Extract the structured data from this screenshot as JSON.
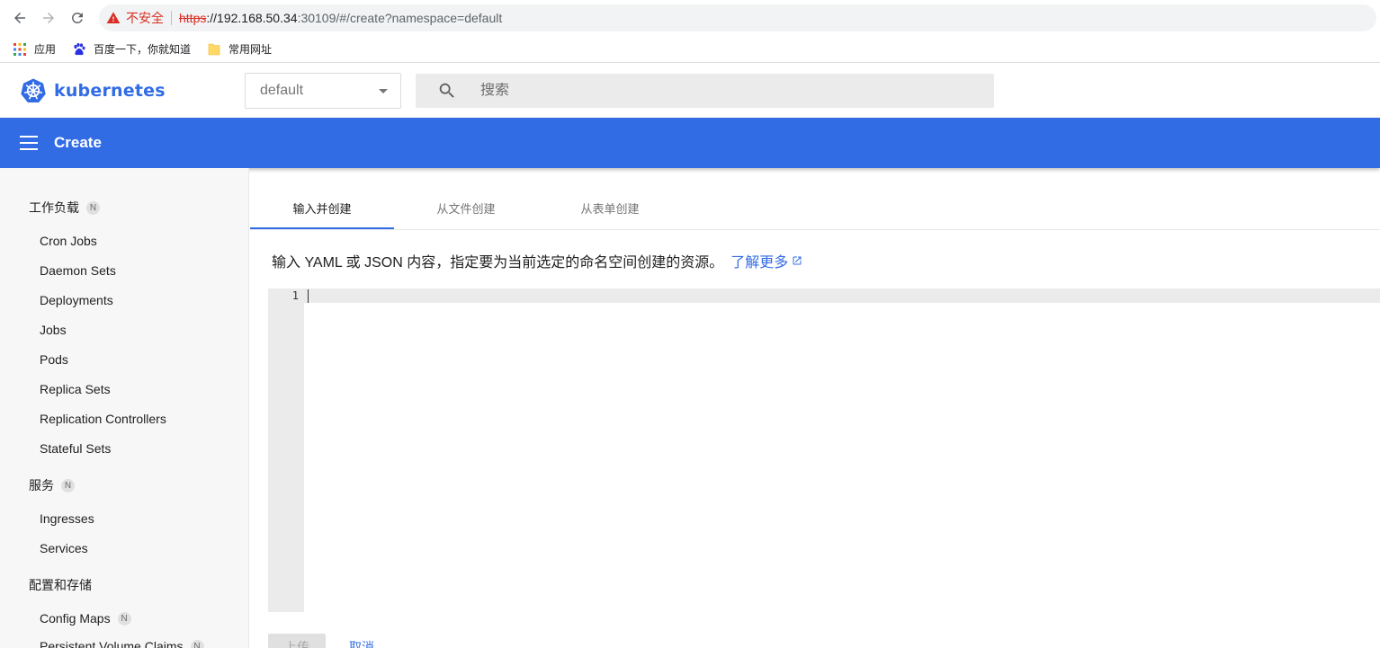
{
  "browser": {
    "security_label": "不安全",
    "url_scheme": "https",
    "url_host": "://192.168.50.34",
    "url_rest": ":30109/#/create?namespace=default",
    "bookmarks": [
      {
        "label": "应用",
        "icon": "apps-grid-icon"
      },
      {
        "label": "百度一下，你就知道",
        "icon": "baidu-paw-icon"
      },
      {
        "label": "常用网址",
        "icon": "folder-icon"
      }
    ]
  },
  "header": {
    "brand": "kubernetes",
    "namespace_selected": "default",
    "search_placeholder": "搜索"
  },
  "toolbar": {
    "title": "Create"
  },
  "sidebar": {
    "workloads": {
      "title": "工作负载",
      "badge": "N"
    },
    "workload_items": [
      "Cron Jobs",
      "Daemon Sets",
      "Deployments",
      "Jobs",
      "Pods",
      "Replica Sets",
      "Replication Controllers",
      "Stateful Sets"
    ],
    "services": {
      "title": "服务",
      "badge": "N"
    },
    "service_items": [
      "Ingresses",
      "Services"
    ],
    "config": {
      "title": "配置和存储"
    },
    "config_items": [
      {
        "label": "Config Maps",
        "badge": "N"
      },
      {
        "label": "Persistent Volume Claims",
        "badge": "N"
      }
    ]
  },
  "main": {
    "tabs": [
      "输入并创建",
      "从文件创建",
      "从表单创建"
    ],
    "description": "输入 YAML 或 JSON 内容，指定要为当前选定的命名空间创建的资源。",
    "learn_more": "了解更多",
    "line_number": "1",
    "upload_label": "上传",
    "cancel_label": "取消"
  },
  "colors": {
    "accent": "#326ce5",
    "sidebar_bg": "#f7f7f7",
    "warning": "#d93025"
  }
}
